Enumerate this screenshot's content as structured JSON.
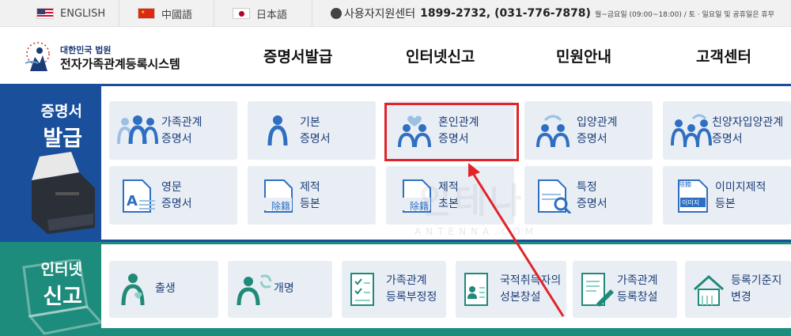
{
  "top_bar": {
    "languages": [
      {
        "label": "ENGLISH",
        "flag": "us-flag"
      },
      {
        "label": "中國語",
        "flag": "china-flag"
      },
      {
        "label": "日本語",
        "flag": "japan-flag"
      }
    ],
    "contact_label": "사용자지원센터",
    "contact_numbers": "1899-2732, (031-776-7878)",
    "contact_hours": "월~금요일 (09:00~18:00) / 토 · 일요일 및 공휴일은 휴무"
  },
  "header": {
    "logo_line1": "대한민국 법원",
    "logo_line2": "전자가족관계등록시스템",
    "nav": [
      "증명서발급",
      "인터넷신고",
      "민원안내",
      "고객센터"
    ]
  },
  "certificates": {
    "category_line1": "증명서",
    "category_line2": "발급",
    "tiles": [
      {
        "line1": "가족관계",
        "line2": "증명서",
        "icon": "family-icon"
      },
      {
        "line1": "기본",
        "line2": "증명서",
        "icon": "person-icon"
      },
      {
        "line1": "혼인관계",
        "line2": "증명서",
        "icon": "marriage-icon"
      },
      {
        "line1": "입양관계",
        "line2": "증명서",
        "icon": "adoption-icon"
      },
      {
        "line1": "친양자입양관계",
        "line2": "증명서",
        "icon": "full-adoption-icon"
      },
      {
        "line1": "영문",
        "line2": "증명서",
        "icon": "english-doc-icon"
      },
      {
        "line1": "제적",
        "line2": "등본",
        "icon": "removed-register-icon",
        "badge": "除籍"
      },
      {
        "line1": "제적",
        "line2": "초본",
        "icon": "removed-abstract-icon",
        "badge": "除籍"
      },
      {
        "line1": "특정",
        "line2": "증명서",
        "icon": "doc-search-icon"
      },
      {
        "line1": "이미지제적",
        "line2": "등본",
        "icon": "image-register-icon",
        "badge_top": "除籍",
        "badge": "이미지"
      }
    ]
  },
  "reports": {
    "category_line1": "인터넷",
    "category_line2": "신고",
    "tiles": [
      {
        "line1": "출생",
        "icon": "birth-icon"
      },
      {
        "line1": "개명",
        "icon": "rename-icon"
      },
      {
        "line1": "가족관계",
        "line2": "등록부정정",
        "icon": "checklist-icon"
      },
      {
        "line1": "국적취득자의",
        "line2": "성본창설",
        "icon": "id-card-icon"
      },
      {
        "line1": "가족관계",
        "line2": "등록창설",
        "icon": "doc-pen-icon"
      },
      {
        "line1": "등록기준지",
        "line2": "변경",
        "icon": "house-icon"
      }
    ]
  },
  "watermark": {
    "text": "인테나",
    "sub": "ANTENNA.COM"
  },
  "colors": {
    "primary_band": "#1a4f9c",
    "secondary_band": "#1e8c7c",
    "highlight": "#e0242a",
    "icon_blue": "#2f6fc2",
    "icon_teal": "#1f8a78"
  }
}
